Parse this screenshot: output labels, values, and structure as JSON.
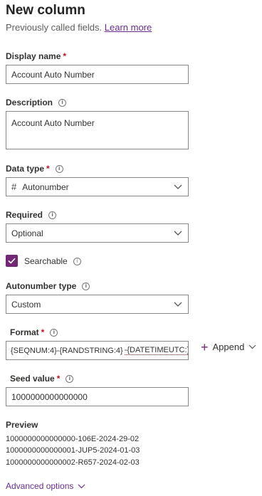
{
  "panel": {
    "title": "New column",
    "subtitle": "Previously called fields.",
    "learn_more": "Learn more"
  },
  "display_name": {
    "label": "Display name",
    "required_mark": "*",
    "value": "Account Auto Number"
  },
  "description": {
    "label": "Description",
    "value": "Account Auto Number"
  },
  "data_type": {
    "label": "Data type",
    "required_mark": "*",
    "icon_glyph": "#",
    "value": "Autonumber"
  },
  "required": {
    "label": "Required",
    "value": "Optional"
  },
  "searchable": {
    "label": "Searchable",
    "checked": true
  },
  "autonumber_type": {
    "label": "Autonumber type",
    "value": "Custom"
  },
  "format": {
    "label": "Format",
    "required_mark": "*",
    "value_part1": "{SEQNUM:4}-{RANDSTRING:4}",
    "value_part2": "-{DATETIMEUTC:}",
    "append_label": "Append"
  },
  "seed_value": {
    "label": "Seed value",
    "required_mark": "*",
    "value": "1000000000000000"
  },
  "preview": {
    "label": "Preview",
    "lines": [
      "1000000000000000-106E-2024-29-02",
      "1000000000000001-JUP5-2024-01-03",
      "1000000000000002-R657-2024-02-03"
    ]
  },
  "advanced_options": {
    "label": "Advanced options"
  },
  "colors": {
    "accent": "#742774",
    "link": "#6a2c91",
    "required": "#c50f1f",
    "border": "#8a8886"
  },
  "icons": [
    "info-icon",
    "chevron-down-icon",
    "check-icon",
    "plus-icon",
    "hash-icon"
  ]
}
